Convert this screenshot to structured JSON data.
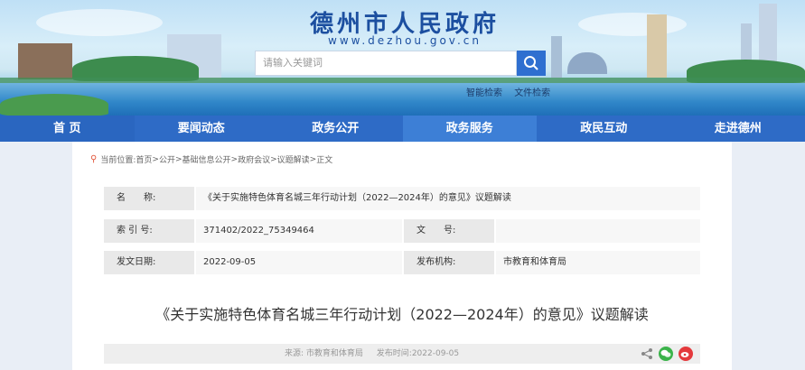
{
  "header": {
    "site_title": "德州市人民政府",
    "site_url": "www.dezhou.gov.cn",
    "search_placeholder": "请输入关键词",
    "links": [
      "智能检索",
      "文件检索"
    ]
  },
  "nav": {
    "items": [
      "首 页",
      "要闻动态",
      "政务公开",
      "政务服务",
      "政民互动",
      "走进德州"
    ],
    "active_index": 3
  },
  "breadcrumb": {
    "label": "当前位置:",
    "items": [
      "首页",
      "公开",
      "基础信息公开",
      "政府会议",
      "议题解读",
      "正文"
    ],
    "separator": ">"
  },
  "info": {
    "name_label": "名　　称:",
    "name_value": "《关于实施特色体育名城三年行动计划（2022—2024年）的意见》议题解读",
    "index_label": "索 引 号:",
    "index_value": "371402/2022_75349464",
    "doc_no_label": "文　　号:",
    "doc_no_value": "",
    "date_label": "发文日期:",
    "date_value": "2022-09-05",
    "org_label": "发布机构:",
    "org_value": "市教育和体育局"
  },
  "article": {
    "title": "《关于实施特色体育名城三年行动计划（2022—2024年）的意见》议题解读",
    "source": "来源: 市教育和体育局",
    "publish_time": "发布时间:2022-09-05"
  },
  "colors": {
    "nav_bg": "#2e6bc6",
    "title_blue": "#1c4fa0",
    "wechat": "#3bb34a",
    "weibo": "#e4393c"
  }
}
